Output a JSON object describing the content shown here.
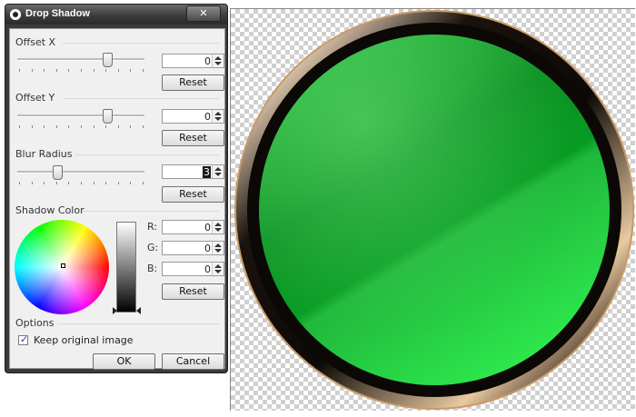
{
  "dialog": {
    "title": "Drop Shadow",
    "close_label": "✕",
    "offset_x": {
      "label": "Offset X",
      "value": "0",
      "reset_label": "Reset",
      "slider_fraction": 0.73
    },
    "offset_y": {
      "label": "Offset Y",
      "value": "0",
      "reset_label": "Reset",
      "slider_fraction": 0.73
    },
    "blur_radius": {
      "label": "Blur Radius",
      "value": "3",
      "reset_label": "Reset",
      "slider_fraction": 0.3
    },
    "shadow_color": {
      "label": "Shadow Color",
      "r_label": "R:",
      "r_value": "0",
      "g_label": "G:",
      "g_value": "0",
      "b_label": "B:",
      "b_value": "0",
      "reset_label": "Reset"
    },
    "options": {
      "label": "Options",
      "keep_original_label": "Keep original image",
      "keep_original_checked": true
    },
    "ok_label": "OK",
    "cancel_label": "Cancel"
  },
  "colors": {
    "button_green": "#1db336",
    "ring_gold": "#d8b48a",
    "ring_dark": "#1a1210",
    "titlebar": "#3c3c3c"
  },
  "icons": {
    "app": "app-logo-icon",
    "close": "close-icon",
    "spin_up": "spin-up-icon",
    "spin_down": "spin-down-icon",
    "checkbox_mark": "checkmark-icon"
  }
}
